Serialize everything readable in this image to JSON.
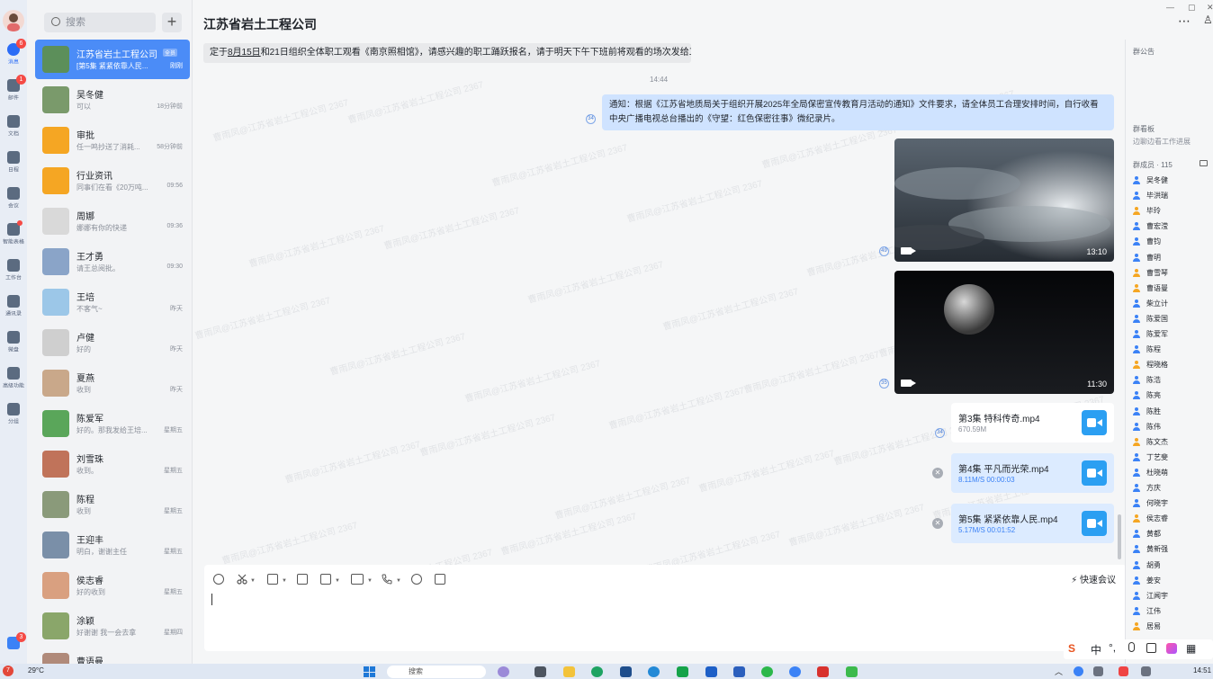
{
  "app": {
    "window_title": "江苏省岩土工程公司"
  },
  "nav": {
    "items": [
      {
        "label": "消息",
        "icon": "chat-bubble-icon",
        "badge": "6",
        "active": true
      },
      {
        "label": "邮件",
        "icon": "mail-icon",
        "badge": "1"
      },
      {
        "label": "文档",
        "icon": "document-icon"
      },
      {
        "label": "日程",
        "icon": "calendar-icon"
      },
      {
        "label": "会议",
        "icon": "video-meeting-icon"
      },
      {
        "label": "智能表格",
        "icon": "smart-table-icon",
        "dot": true
      },
      {
        "label": "工作台",
        "icon": "grid-apps-icon"
      },
      {
        "label": "通讯录",
        "icon": "contacts-tree-icon"
      },
      {
        "label": "微盘",
        "icon": "cloud-disk-icon"
      },
      {
        "label": "高级功能",
        "icon": "sparkle-icon"
      },
      {
        "label": "分组",
        "icon": "folder-group-icon"
      }
    ],
    "bottom_badge": "3"
  },
  "search": {
    "placeholder": "搜索"
  },
  "conversations": [
    {
      "name": "江苏省岩土工程公司",
      "tag": "全员",
      "preview": "[第5集 紧紧依靠人民...",
      "time": "刚刚",
      "selected": true,
      "color": "#5c8f5a"
    },
    {
      "name": "吴冬健",
      "preview": "可以",
      "time": "18分钟前",
      "color": "#7a9a6b"
    },
    {
      "name": "审批",
      "preview": "任一鸣抄送了消耗...",
      "time": "58分钟前",
      "color": "#f5a623"
    },
    {
      "name": "行业资讯",
      "preview": "同事们在看《20万吨...",
      "time": "09:56",
      "color": "#f5a623"
    },
    {
      "name": "周娜",
      "preview": "娜娜有你的快递",
      "time": "09:36",
      "color": "#d9d9d9"
    },
    {
      "name": "王才勇",
      "preview": "请王总阅批。",
      "time": "09:30",
      "color": "#8aa4c8"
    },
    {
      "name": "王培",
      "preview": "不客气~",
      "time": "昨天",
      "color": "#9cc7e8"
    },
    {
      "name": "卢健",
      "preview": "好的",
      "time": "昨天",
      "color": "#cfcfcf"
    },
    {
      "name": "夏燕",
      "preview": "收到",
      "time": "昨天",
      "color": "#c9a88a"
    },
    {
      "name": "陈爱军",
      "preview": "好的。那我发给王培...",
      "time": "星期五",
      "color": "#5aa65a"
    },
    {
      "name": "刘雪珠",
      "preview": "收到。",
      "time": "星期五",
      "color": "#c0735a"
    },
    {
      "name": "陈程",
      "preview": "收到",
      "time": "星期五",
      "color": "#8a9a7a"
    },
    {
      "name": "王迎丰",
      "preview": "明白，谢谢主任",
      "time": "星期五",
      "color": "#7a8fa8"
    },
    {
      "name": "侯志睿",
      "preview": "好的收到",
      "time": "星期五",
      "color": "#d9a080"
    },
    {
      "name": "涂颖",
      "preview": "好谢谢 我一会去拿",
      "time": "星期四",
      "color": "#8aa66a"
    },
    {
      "name": "曹语曼",
      "preview": "",
      "time": "",
      "color": "#b08a7a"
    }
  ],
  "chat": {
    "title": "江苏省岩土工程公司",
    "watermark": "曹雨凤@江苏省岩土工程公司 2367",
    "pinned_pre": "定于",
    "pinned_date": "8月15日",
    "pinned_post": "和21日组织全体职工观看《南京照相馆》，请感兴趣的职工踊跃报名，请于明天下午下班前将观看的场次发给工会。",
    "timestamp": "14:44",
    "notice_text": "通知：根据《江苏省地质局关于组织开展2025年全局保密宣传教育月活动的通知》文件要求，请全体员工合理安排时间，自行收看中央广播电视总台播出的《守望：红色保密往事》微纪录片。",
    "notice_read": "34",
    "videos": [
      {
        "duration": "13:10",
        "read": "49"
      },
      {
        "duration": "11:30",
        "read": "35"
      }
    ],
    "files": [
      {
        "name": "第3集 特科传奇.mp4",
        "info": "670.59M",
        "read": "34",
        "downloading": false
      },
      {
        "name": "第4集 平凡而光荣.mp4",
        "info": "8.11M/S    00:00:03",
        "downloading": true
      },
      {
        "name": "第5集 紧紧依靠人民.mp4",
        "info": "5.17M/S    00:01:52",
        "downloading": true
      }
    ]
  },
  "composer": {
    "quick_meeting": "快速会议",
    "tools": [
      "emoji-icon",
      "scissors-icon",
      "image-icon",
      "doc-icon",
      "checkbox-icon",
      "folder-icon",
      "phone-icon",
      "more-icon",
      "note-icon"
    ]
  },
  "right_panel": {
    "announcement_label": "群公告",
    "board_label": "群看板",
    "board_hint": "边聊边看工作进展",
    "members_label": "群成员 · 115",
    "members": [
      {
        "name": "吴冬健"
      },
      {
        "name": "毕洪瑞"
      },
      {
        "name": "毕玲",
        "owner": true
      },
      {
        "name": "曹宏滢"
      },
      {
        "name": "曹钧"
      },
      {
        "name": "曹明"
      },
      {
        "name": "曹雪琴",
        "owner": true
      },
      {
        "name": "曹语曼",
        "owner": true
      },
      {
        "name": "柴立计"
      },
      {
        "name": "陈爱国"
      },
      {
        "name": "陈爱军"
      },
      {
        "name": "陈程"
      },
      {
        "name": "程晓格",
        "owner": true
      },
      {
        "name": "陈浩"
      },
      {
        "name": "陈亮"
      },
      {
        "name": "陈胜"
      },
      {
        "name": "陈伟"
      },
      {
        "name": "陈文杰",
        "owner": true
      },
      {
        "name": "丁艺斐"
      },
      {
        "name": "杜晓萌"
      },
      {
        "name": "方庆"
      },
      {
        "name": "何晓宇"
      },
      {
        "name": "侯志睿",
        "owner": true
      },
      {
        "name": "黄都"
      },
      {
        "name": "黄新强"
      },
      {
        "name": "胡勇"
      },
      {
        "name": "姜安"
      },
      {
        "name": "江闻宇"
      },
      {
        "name": "江伟"
      },
      {
        "name": "居易",
        "owner": true
      }
    ]
  },
  "ime": {
    "lang": "中"
  },
  "taskbar": {
    "weather": "29°C",
    "weather_badge": "7",
    "search_placeholder": "搜索",
    "time": "14:51"
  }
}
